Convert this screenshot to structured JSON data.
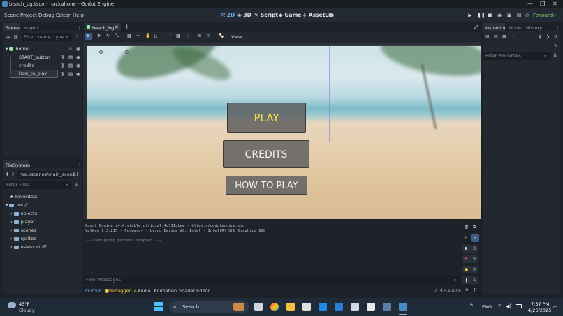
{
  "window": {
    "title": "beach_bg.tscn - hackahone - Godot Engine",
    "controls": [
      "—",
      "❐",
      "✕"
    ]
  },
  "menubar": {
    "items": [
      "Scene",
      "Project",
      "Debug",
      "Editor",
      "Help"
    ],
    "workspaces": [
      {
        "label": "2D",
        "active": true
      },
      {
        "label": "3D",
        "active": false
      },
      {
        "label": "Script",
        "active": false
      },
      {
        "label": "Game",
        "active": false
      },
      {
        "label": "AssetLib",
        "active": false
      }
    ],
    "renderer": "Forward+"
  },
  "scene_dock": {
    "tabs": [
      "Scene",
      "Import"
    ],
    "filter_placeholder": "Filter: name, type...",
    "nodes": [
      {
        "name": "home",
        "indent": 0
      },
      {
        "name": "START_button",
        "indent": 1
      },
      {
        "name": "credits",
        "indent": 1
      },
      {
        "name": "how_to_play",
        "indent": 1
      }
    ]
  },
  "filesystem": {
    "tab": "FileSystem",
    "path": "res://scenes/main_scene.t",
    "filter_placeholder": "Filter Files",
    "favorites_label": "Favorites:",
    "root": "res://",
    "folders": [
      "objects",
      "player",
      "scenes",
      "sprites",
      "usless stuff"
    ]
  },
  "editor_tabs": {
    "active": "beach_bg",
    "close": "✕",
    "add": "+"
  },
  "toolbar": {
    "view_label": "View"
  },
  "viewport": {
    "buttons": {
      "play": "PLAY",
      "credits": "CREDITS",
      "how_to_play": "HOW TO PLAY"
    },
    "play_color": "#f0e04a"
  },
  "output": {
    "lines": [
      "Godot Engine v4.4.stable.official.4c311cbee - https://godotengine.org",
      "Vulkan 1.3.215 - Forward+ - Using Device #0: Intel - Intel(R) UHD Graphics 620",
      "",
      "--- Debugging process stopped ---"
    ],
    "filter_placeholder": "Filter Messages",
    "counts": {
      "messages": "3",
      "errors": "0",
      "warnings": "0",
      "info": "1"
    },
    "tabs": [
      "Output",
      "Debugger (4)",
      "Audio",
      "Animation",
      "Shader Editor"
    ],
    "version": "4.4.stable"
  },
  "inspector": {
    "tabs": [
      "Inspector",
      "Node",
      "History"
    ],
    "filter_placeholder": "Filter Properties"
  },
  "taskbar": {
    "weather_temp": "43°F",
    "weather_desc": "Cloudy",
    "search_placeholder": "Search",
    "lang": "ENG",
    "time": "7:37 PM",
    "date": "4/26/2025"
  },
  "colors": {
    "accent": "#478cbf",
    "workspace_active": "#6cb0f2",
    "renderer": "#7dd36a"
  }
}
